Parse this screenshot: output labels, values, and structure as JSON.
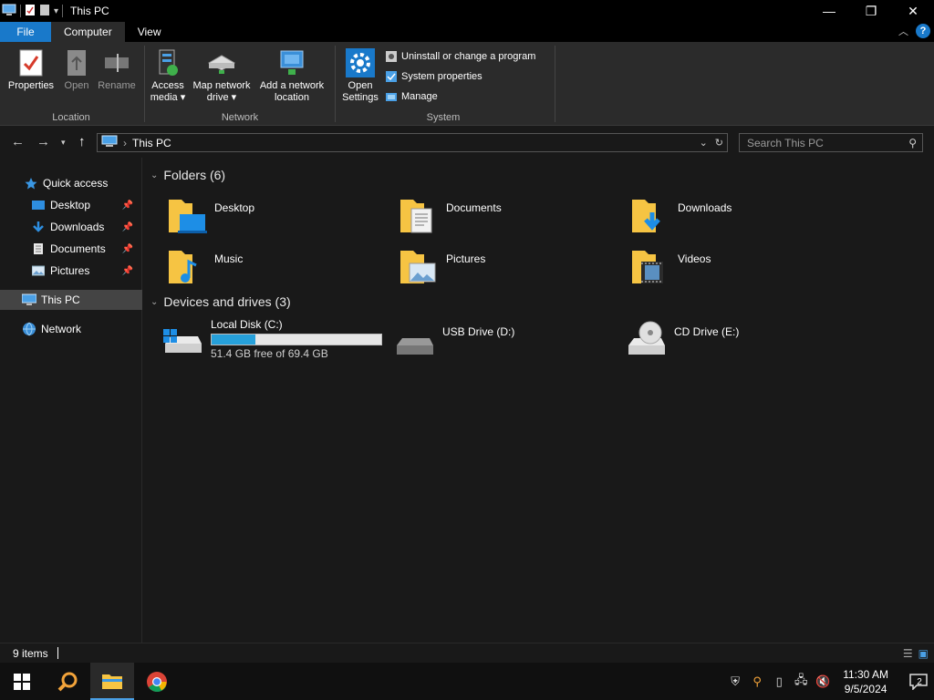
{
  "titlebar": {
    "title": "This PC",
    "minimize_glyph": "—",
    "restore_glyph": "❐",
    "close_glyph": "✕"
  },
  "ribbon_tabs": {
    "file": "File",
    "computer": "Computer",
    "view": "View"
  },
  "ribbon": {
    "location": {
      "label": "Location",
      "properties": "Properties",
      "open": "Open",
      "rename": "Rename"
    },
    "network": {
      "label": "Network",
      "access_media": [
        "Access",
        "media ▾"
      ],
      "map_drive": [
        "Map network",
        "drive ▾"
      ],
      "add_location": [
        "Add a network",
        "location"
      ]
    },
    "system": {
      "label": "System",
      "open_settings": [
        "Open",
        "Settings"
      ],
      "uninstall": "Uninstall or change a program",
      "system_properties": "System properties",
      "manage": "Manage"
    }
  },
  "address": {
    "path": "This PC",
    "search_placeholder": "Search This PC"
  },
  "sidebar": {
    "quick_access": "Quick access",
    "items": [
      "Desktop",
      "Downloads",
      "Documents",
      "Pictures"
    ],
    "this_pc": "This PC",
    "network": "Network"
  },
  "folders": {
    "heading": "Folders (6)",
    "items": [
      "Desktop",
      "Documents",
      "Downloads",
      "Music",
      "Pictures",
      "Videos"
    ]
  },
  "drives": {
    "heading": "Devices and drives (3)",
    "local": {
      "name": "Local Disk (C:)",
      "free_text": "51.4 GB free of 69.4 GB",
      "used_fraction": 0.26
    },
    "usb": {
      "name": "USB Drive (D:)"
    },
    "cd": {
      "name": "CD Drive (E:)"
    }
  },
  "status": {
    "count": "9 items"
  },
  "taskbar": {
    "time": "11:30 AM",
    "date": "9/5/2024",
    "notification_count": "2"
  },
  "colors": {
    "accent": "#1979ca",
    "folder": "#f6c443",
    "bar_fill": "#26a0da"
  }
}
